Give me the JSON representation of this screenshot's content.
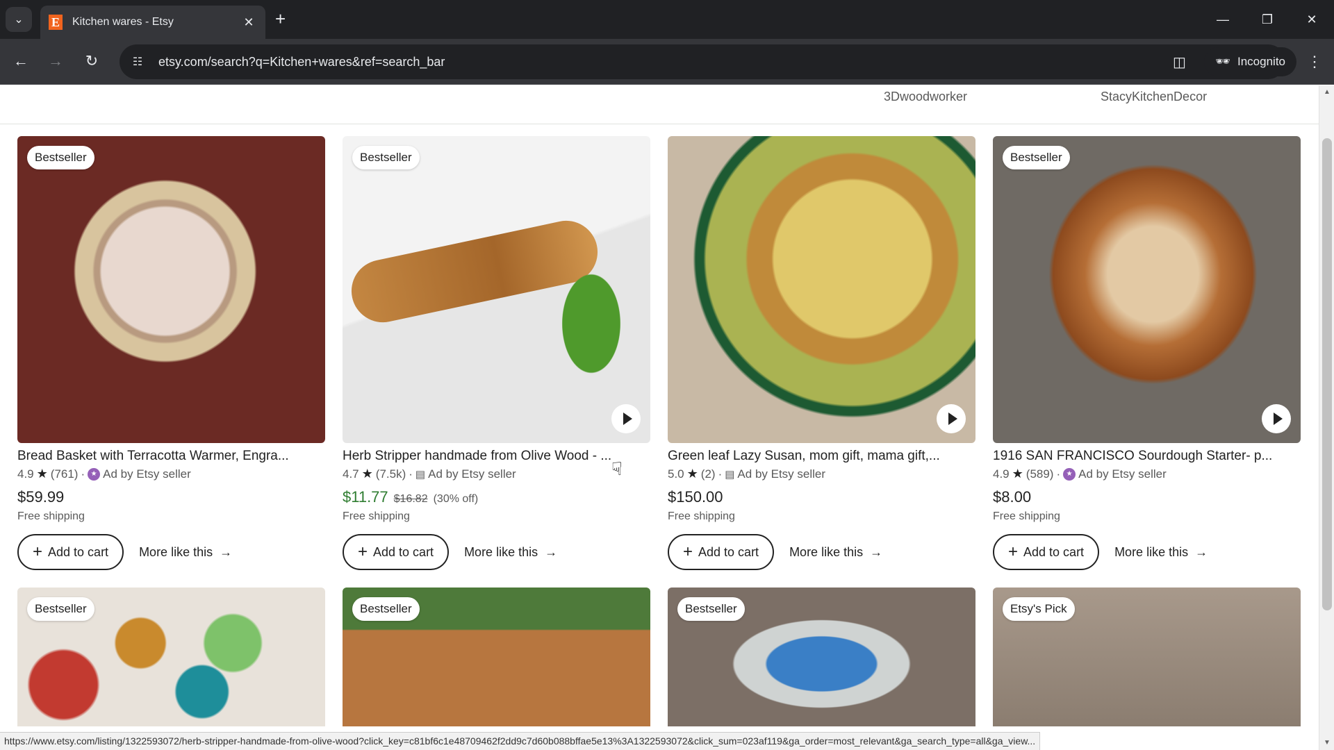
{
  "browser": {
    "tab": {
      "title": "Kitchen wares - Etsy",
      "favicon_letter": "E"
    },
    "new_tab_icon": "+",
    "url": "etsy.com/search?q=Kitchen+wares&ref=search_bar",
    "profile_label": "Incognito"
  },
  "page": {
    "shop_names": [
      "3Dwoodworker",
      "StacyKitchenDecor"
    ],
    "listings": [
      {
        "badge": "Bestseller",
        "title": "Bread Basket with Terracotta Warmer, Engra...",
        "rating": "4.9",
        "reviews": "(761)",
        "ad_label": "Ad by Etsy seller",
        "ad_icon": "star-seller-icon",
        "price": "$59.99",
        "shipping": "Free shipping",
        "has_video": false
      },
      {
        "badge": "Bestseller",
        "title": "Herb Stripper handmade from Olive Wood - ...",
        "rating": "4.7",
        "reviews": "(7.5k)",
        "ad_label": "Ad by Etsy seller",
        "ad_icon": "shop-icon",
        "price": "$11.77",
        "original_price": "$16.82",
        "discount": "(30% off)",
        "shipping": "Free shipping",
        "has_video": true
      },
      {
        "title": "Green leaf Lazy Susan, mom gift, mama gift,...",
        "rating": "5.0",
        "reviews": "(2)",
        "ad_label": "Ad by Etsy seller",
        "ad_icon": "shop-icon",
        "price": "$150.00",
        "shipping": "Free shipping",
        "has_video": true
      },
      {
        "badge": "Bestseller",
        "title": "1916 SAN FRANCISCO Sourdough Starter- p...",
        "rating": "4.9",
        "reviews": "(589)",
        "ad_label": "Ad by Etsy seller",
        "ad_icon": "star-seller-icon",
        "price": "$8.00",
        "shipping": "Free shipping",
        "has_video": true
      }
    ],
    "second_row_badges": [
      "Bestseller",
      "Bestseller",
      "Bestseller",
      "Etsy's Pick"
    ],
    "add_to_cart_label": "Add to cart",
    "more_like_this_label": "More like this",
    "sale_color": "#2f7d31",
    "star_seller_color": "#9560b8"
  },
  "statusbar": {
    "link": "https://www.etsy.com/listing/1322593072/herb-stripper-handmade-from-olive-wood?click_key=c81bf6c1e48709462f2dd9c7d60b088bffae5e13%3A1322593072&click_sum=023af119&ga_order=most_relevant&ga_search_type=all&ga_view..."
  }
}
